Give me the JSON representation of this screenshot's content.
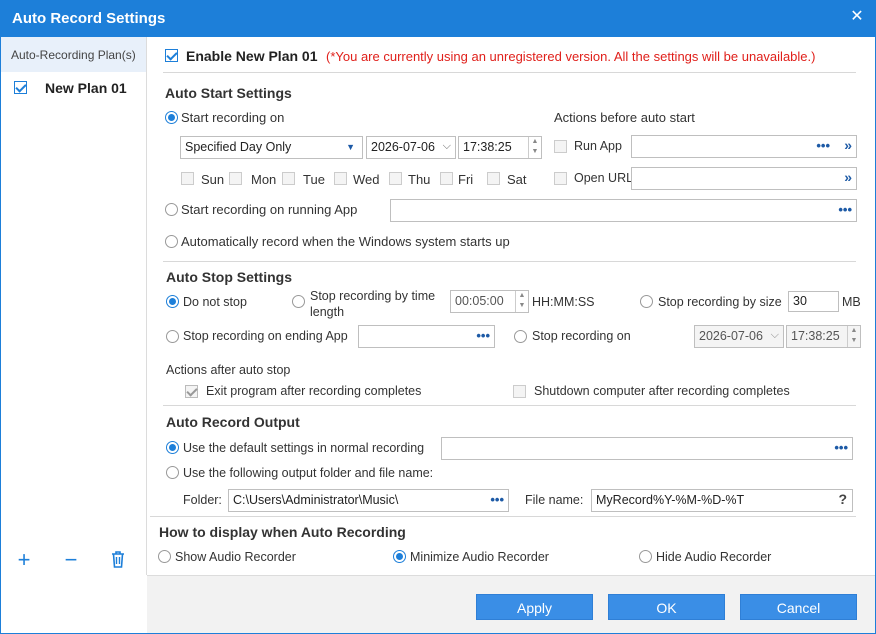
{
  "title": "Auto Record Settings",
  "sidebar": {
    "header": "Auto-Recording Plan(s)",
    "items": [
      {
        "label": "New Plan 01",
        "checked": true
      }
    ]
  },
  "enable": {
    "label": "Enable New Plan 01",
    "warning": "(*You are currently using an unregistered version. All the settings will be unavailable.)"
  },
  "start": {
    "title": "Auto Start Settings",
    "opt_on": "Start recording on",
    "day_select": "Specified Day Only",
    "date": "2026-07-06",
    "time": "17:38:25",
    "days": [
      "Sun",
      "Mon",
      "Tue",
      "Wed",
      "Thu",
      "Fri",
      "Sat"
    ],
    "opt_app": "Start recording on running App",
    "opt_windows": "Automatically record when the Windows system starts up",
    "actions_title": "Actions before auto start",
    "run_app": "Run App",
    "open_url": "Open URL"
  },
  "stop": {
    "title": "Auto Stop Settings",
    "do_not_stop": "Do not stop",
    "by_time": "Stop recording by time length",
    "time_value": "00:05:00",
    "time_unit": "HH:MM:SS",
    "by_size": "Stop recording by size",
    "size_value": "30",
    "size_unit": "MB",
    "ending_app": "Stop recording on ending App",
    "stop_on": "Stop recording on",
    "stop_date": "2026-07-06",
    "stop_time": "17:38:25",
    "actions_after": "Actions after auto stop",
    "exit_program": "Exit program after recording completes",
    "shutdown": "Shutdown computer after recording completes"
  },
  "output": {
    "title": "Auto Record Output",
    "default": "Use the default settings in normal recording",
    "custom": "Use the following output folder and file name:",
    "folder_label": "Folder:",
    "folder_value": "C:\\Users\\Administrator\\Music\\",
    "file_label": "File name:",
    "file_value": "MyRecord%Y-%M-%D-%T"
  },
  "display": {
    "title": "How to display when Auto Recording",
    "show": "Show Audio Recorder",
    "minimize": "Minimize Audio Recorder",
    "hide": "Hide Audio Recorder"
  },
  "buttons": {
    "apply": "Apply",
    "ok": "OK",
    "cancel": "Cancel"
  },
  "colors": {
    "accent": "#1d7fd9",
    "warning": "#e0201b"
  }
}
